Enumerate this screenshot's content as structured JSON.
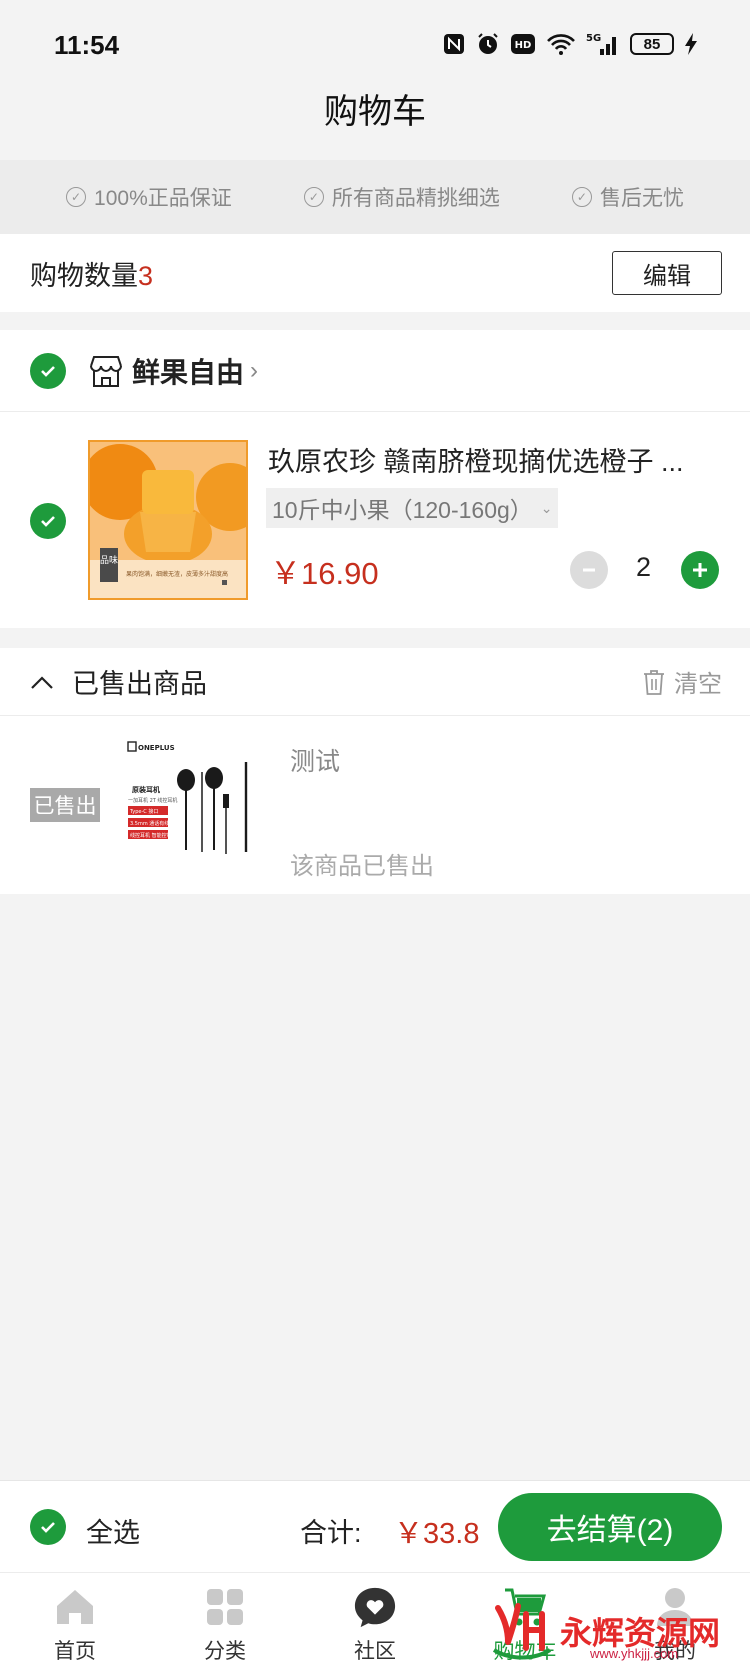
{
  "status_bar": {
    "time": "11:54",
    "network": "5G",
    "battery": "85",
    "icons": [
      "nfc-icon",
      "alarm-icon",
      "hd-icon",
      "wifi-icon",
      "signal-icon",
      "battery-icon",
      "charging-icon"
    ]
  },
  "header": {
    "title": "购物车"
  },
  "guarantees": [
    "100%正品保证",
    "所有商品精挑细选",
    "售后无忧"
  ],
  "cart_count": {
    "label": "购物数量",
    "count": "3",
    "edit_label": "编辑"
  },
  "store": {
    "name": "鲜果自由",
    "product": {
      "title": "玖原农珍 赣南脐橙现摘优选橙子 ...",
      "variant": "10斤中小果（120-160g）",
      "price": "￥16.90",
      "quantity": "2",
      "image_caption_tag": "品味",
      "image_caption": "果肉饱满，细嫩无渣，皮薄多汁甜度高"
    }
  },
  "sold_out": {
    "title": "已售出商品",
    "clear_label": "清空",
    "item": {
      "tag": "已售出",
      "name": "测试",
      "status": "该商品已售出",
      "image_brand": "ONEPLUS",
      "image_title": "原装耳机",
      "image_subtitle": "一加耳机 2T 线控耳机",
      "image_badge1": "Type-C 接口",
      "image_badge2": "3.5mm 通话有线",
      "image_badge3": "线控耳机 智能控制"
    }
  },
  "checkout": {
    "select_all_label": "全选",
    "total_label": "合计:",
    "total_value": "￥33.8",
    "button_label": "去结算(2)"
  },
  "tabs": [
    {
      "label": "首页",
      "icon": "home-icon"
    },
    {
      "label": "分类",
      "icon": "grid-icon"
    },
    {
      "label": "社区",
      "icon": "chat-heart-icon"
    },
    {
      "label": "购物车",
      "icon": "cart-icon",
      "active": true
    },
    {
      "label": "我的",
      "icon": "user-icon"
    }
  ],
  "watermark": {
    "text": "永辉资源网",
    "url": "www.yhkjjj.com"
  },
  "colors": {
    "accent": "#1e9b3c",
    "price": "#c62f1e",
    "background": "#f3f3f3"
  }
}
